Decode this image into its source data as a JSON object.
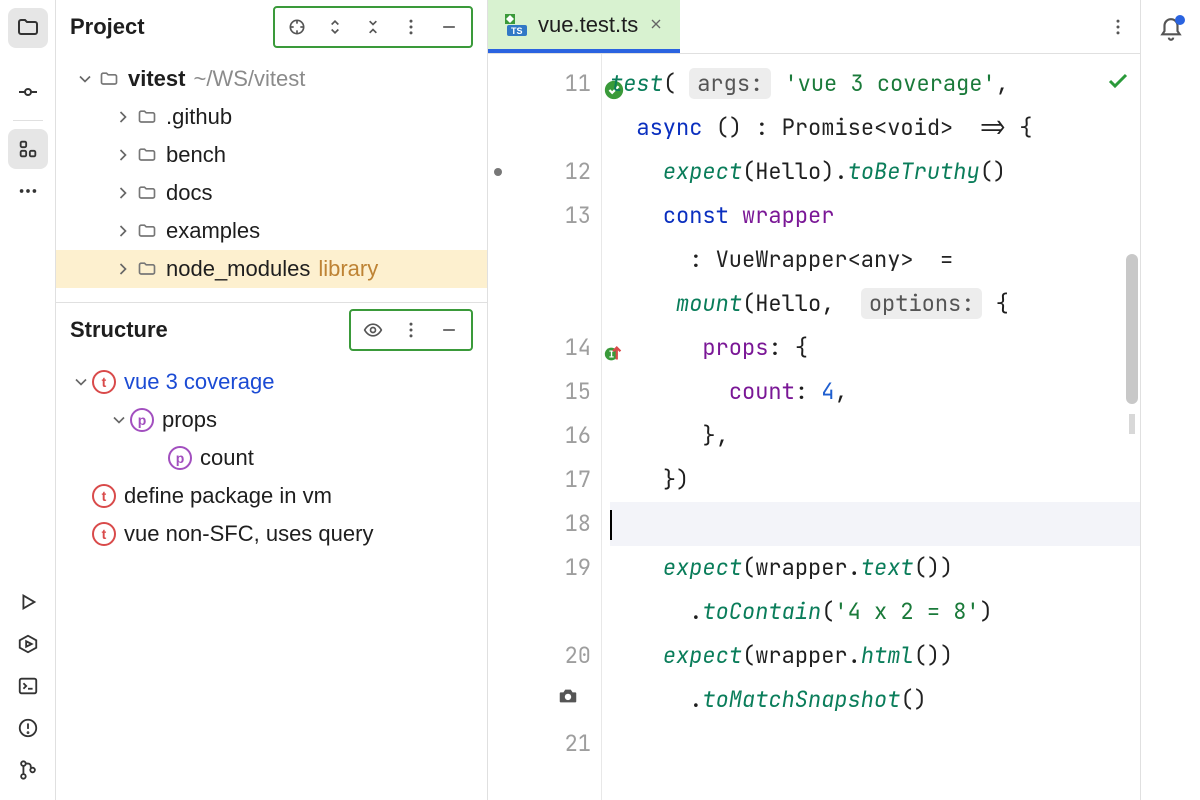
{
  "panels": {
    "project": {
      "title": "Project"
    },
    "structure": {
      "title": "Structure"
    }
  },
  "projectTree": {
    "root": {
      "name": "vitest",
      "path": "~/WS/vitest"
    },
    "children": [
      {
        "name": ".github"
      },
      {
        "name": "bench"
      },
      {
        "name": "docs"
      },
      {
        "name": "examples"
      },
      {
        "name": "node_modules",
        "suffix": "library",
        "highlighted": true
      }
    ]
  },
  "structureTree": [
    {
      "kind": "t",
      "label": "vue 3 coverage",
      "link": true,
      "depth": 0,
      "chevron": "down"
    },
    {
      "kind": "p",
      "label": "props",
      "depth": 1,
      "chevron": "down"
    },
    {
      "kind": "p",
      "label": "count",
      "depth": 2,
      "chevron": "none"
    },
    {
      "kind": "t",
      "label": "define package in vm",
      "depth": 0,
      "chevron": "none",
      "offset": true
    },
    {
      "kind": "t",
      "label": "vue non-SFC, uses query",
      "depth": 0,
      "chevron": "none",
      "offset": true
    }
  ],
  "tab": {
    "filename": "vue.test.ts"
  },
  "gutter": [
    "11",
    "",
    "12",
    "13",
    "",
    "",
    "14",
    "15",
    "16",
    "17",
    "18",
    "19",
    "",
    "20",
    "",
    "21"
  ],
  "code": {
    "l1_test": "test",
    "l1_args": "args:",
    "l1_str": "'vue 3 coverage'",
    "l2_async": "async",
    "l2_sig": " () : Promise<void>  => {",
    "l3_expect": "expect",
    "l3_rest": "(Hello).",
    "l3_tobe": "toBeTruthy",
    "l4_const": "const",
    "l4_wrapper": " wrapper",
    "l5_type": ": VueWrapper<any>  =",
    "l6_mount": "mount",
    "l6_hello": "(Hello,  ",
    "l6_opts": "options:",
    "l6_brace": " {",
    "l7_props": "props",
    "l7_rest": ": {",
    "l8_count": "count",
    "l8_val": "4",
    "l9": "},",
    "l10": "})",
    "l12_expect": "expect",
    "l12_rest": "(wrapper.",
    "l12_text": "text",
    "l13_toContain": "toContain",
    "l13_str": "'4 x 2 = 8'",
    "l14_expect": "expect",
    "l14_rest": "(wrapper.",
    "l14_html": "html",
    "l15_snap": "toMatchSnapshot"
  }
}
